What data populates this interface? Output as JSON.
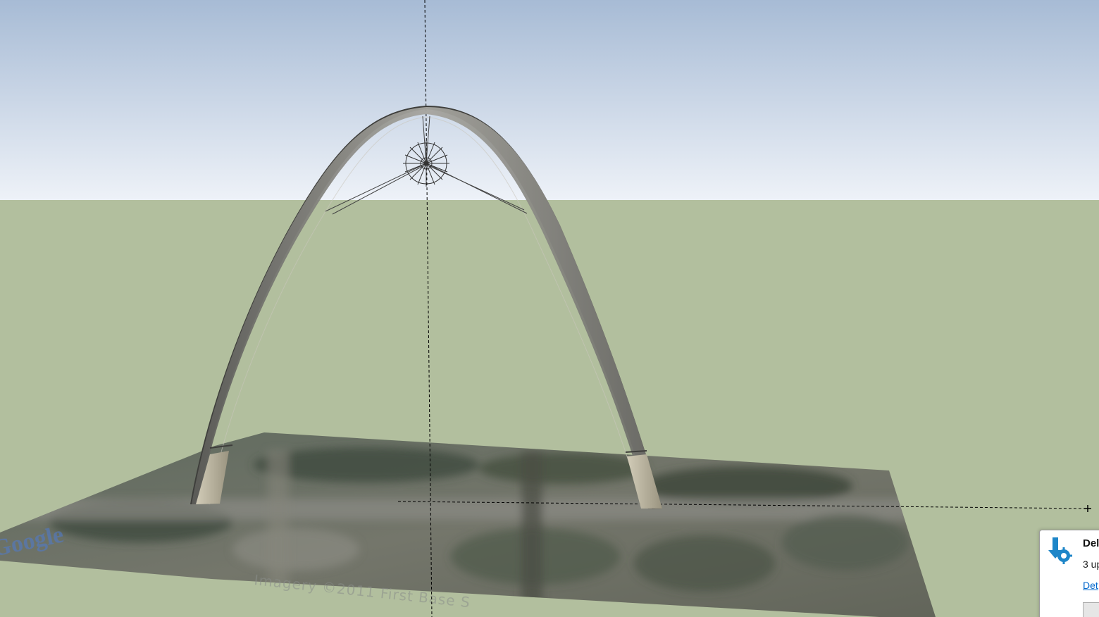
{
  "scene": {
    "sky_top_color": "#a8bcd6",
    "sky_horizon_color": "#eef2f7",
    "ground_color": "#b2bf9e",
    "terrain_color": "#6b6e62",
    "arch_color": "#8a8a86",
    "axis_color": "#000000",
    "imagery_credit": "Imagery ©2011 First Base S",
    "google_logo_text": "Google",
    "icons": [
      "sun-compass-icon",
      "origin-icon"
    ]
  },
  "notification": {
    "title": "Del",
    "body": "3 up",
    "link": "Det",
    "icon": "download-gear-icon",
    "accent_color": "#1e86c8"
  }
}
